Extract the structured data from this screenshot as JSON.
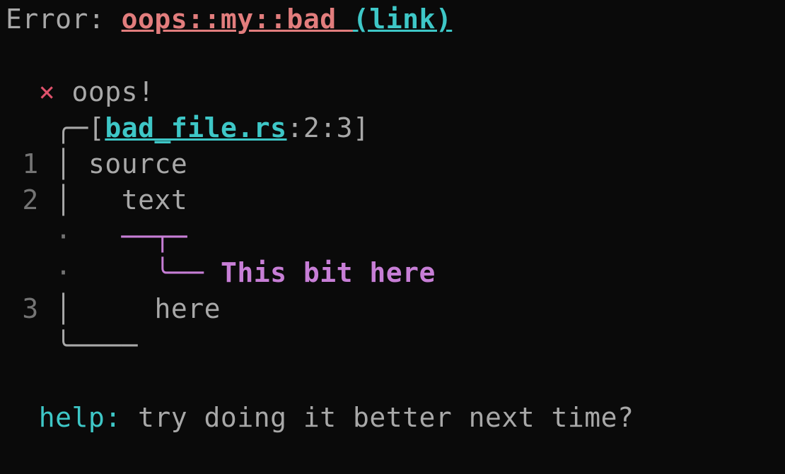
{
  "header": {
    "error_label": "Error: ",
    "error_code": "oops::my::bad ",
    "link_text": "(link)"
  },
  "message": {
    "cross": "×",
    "text": "oops!"
  },
  "source": {
    "filename": "bad_file.rs",
    "line": "2",
    "col": "3"
  },
  "snippet": {
    "lines": [
      {
        "num": "1",
        "text": "source"
      },
      {
        "num": "2",
        "text": "  text"
      },
      {
        "num": "3",
        "text": "    here"
      }
    ],
    "annotation": "This bit here"
  },
  "help": {
    "label": "help: ",
    "text": "try doing it better next time?"
  },
  "glyphs": {
    "corner_tl": "╭",
    "corner_bl": "╰",
    "hline": "─",
    "vline": "│",
    "dot": "·",
    "underline_top": "──┬─",
    "underline_arm": "╰── "
  }
}
